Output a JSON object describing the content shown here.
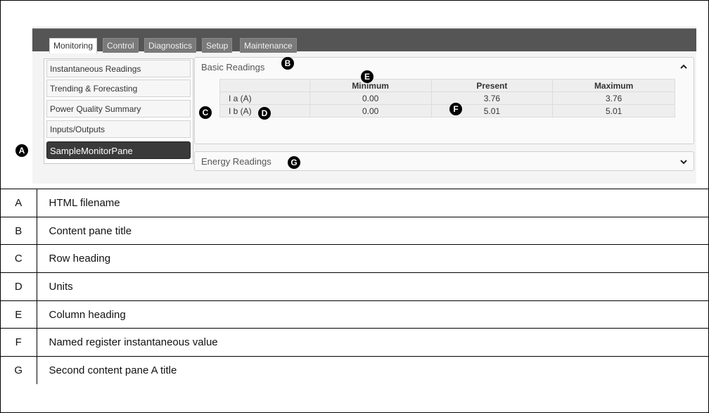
{
  "tabs": [
    "Monitoring",
    "Control",
    "Diagnostics",
    "Setup",
    "Maintenance"
  ],
  "sidebar": {
    "items": [
      "Instantaneous Readings",
      "Trending & Forecasting",
      "Power Quality Summary",
      "Inputs/Outputs",
      "SampleMonitorPane"
    ]
  },
  "basic_pane": {
    "title": "Basic Readings",
    "columns": [
      "",
      "Minimum",
      "Present",
      "Maximum"
    ],
    "rows": [
      {
        "name": "I a (A)",
        "min": "0.00",
        "present": "3.76",
        "max": "3.76"
      },
      {
        "name": "I b (A)",
        "min": "0.00",
        "present": "5.01",
        "max": "5.01"
      }
    ]
  },
  "energy_pane": {
    "title": "Energy Readings"
  },
  "callouts": [
    "A",
    "B",
    "C",
    "D",
    "E",
    "F",
    "G"
  ],
  "legend": [
    {
      "key": "A",
      "desc": "HTML filename"
    },
    {
      "key": "B",
      "desc": "Content pane title"
    },
    {
      "key": "C",
      "desc": "Row heading"
    },
    {
      "key": "D",
      "desc": "Units"
    },
    {
      "key": "E",
      "desc": "Column heading"
    },
    {
      "key": "F",
      "desc": "Named register instantaneous value"
    },
    {
      "key": "G",
      "desc": "Second content pane A title"
    }
  ]
}
